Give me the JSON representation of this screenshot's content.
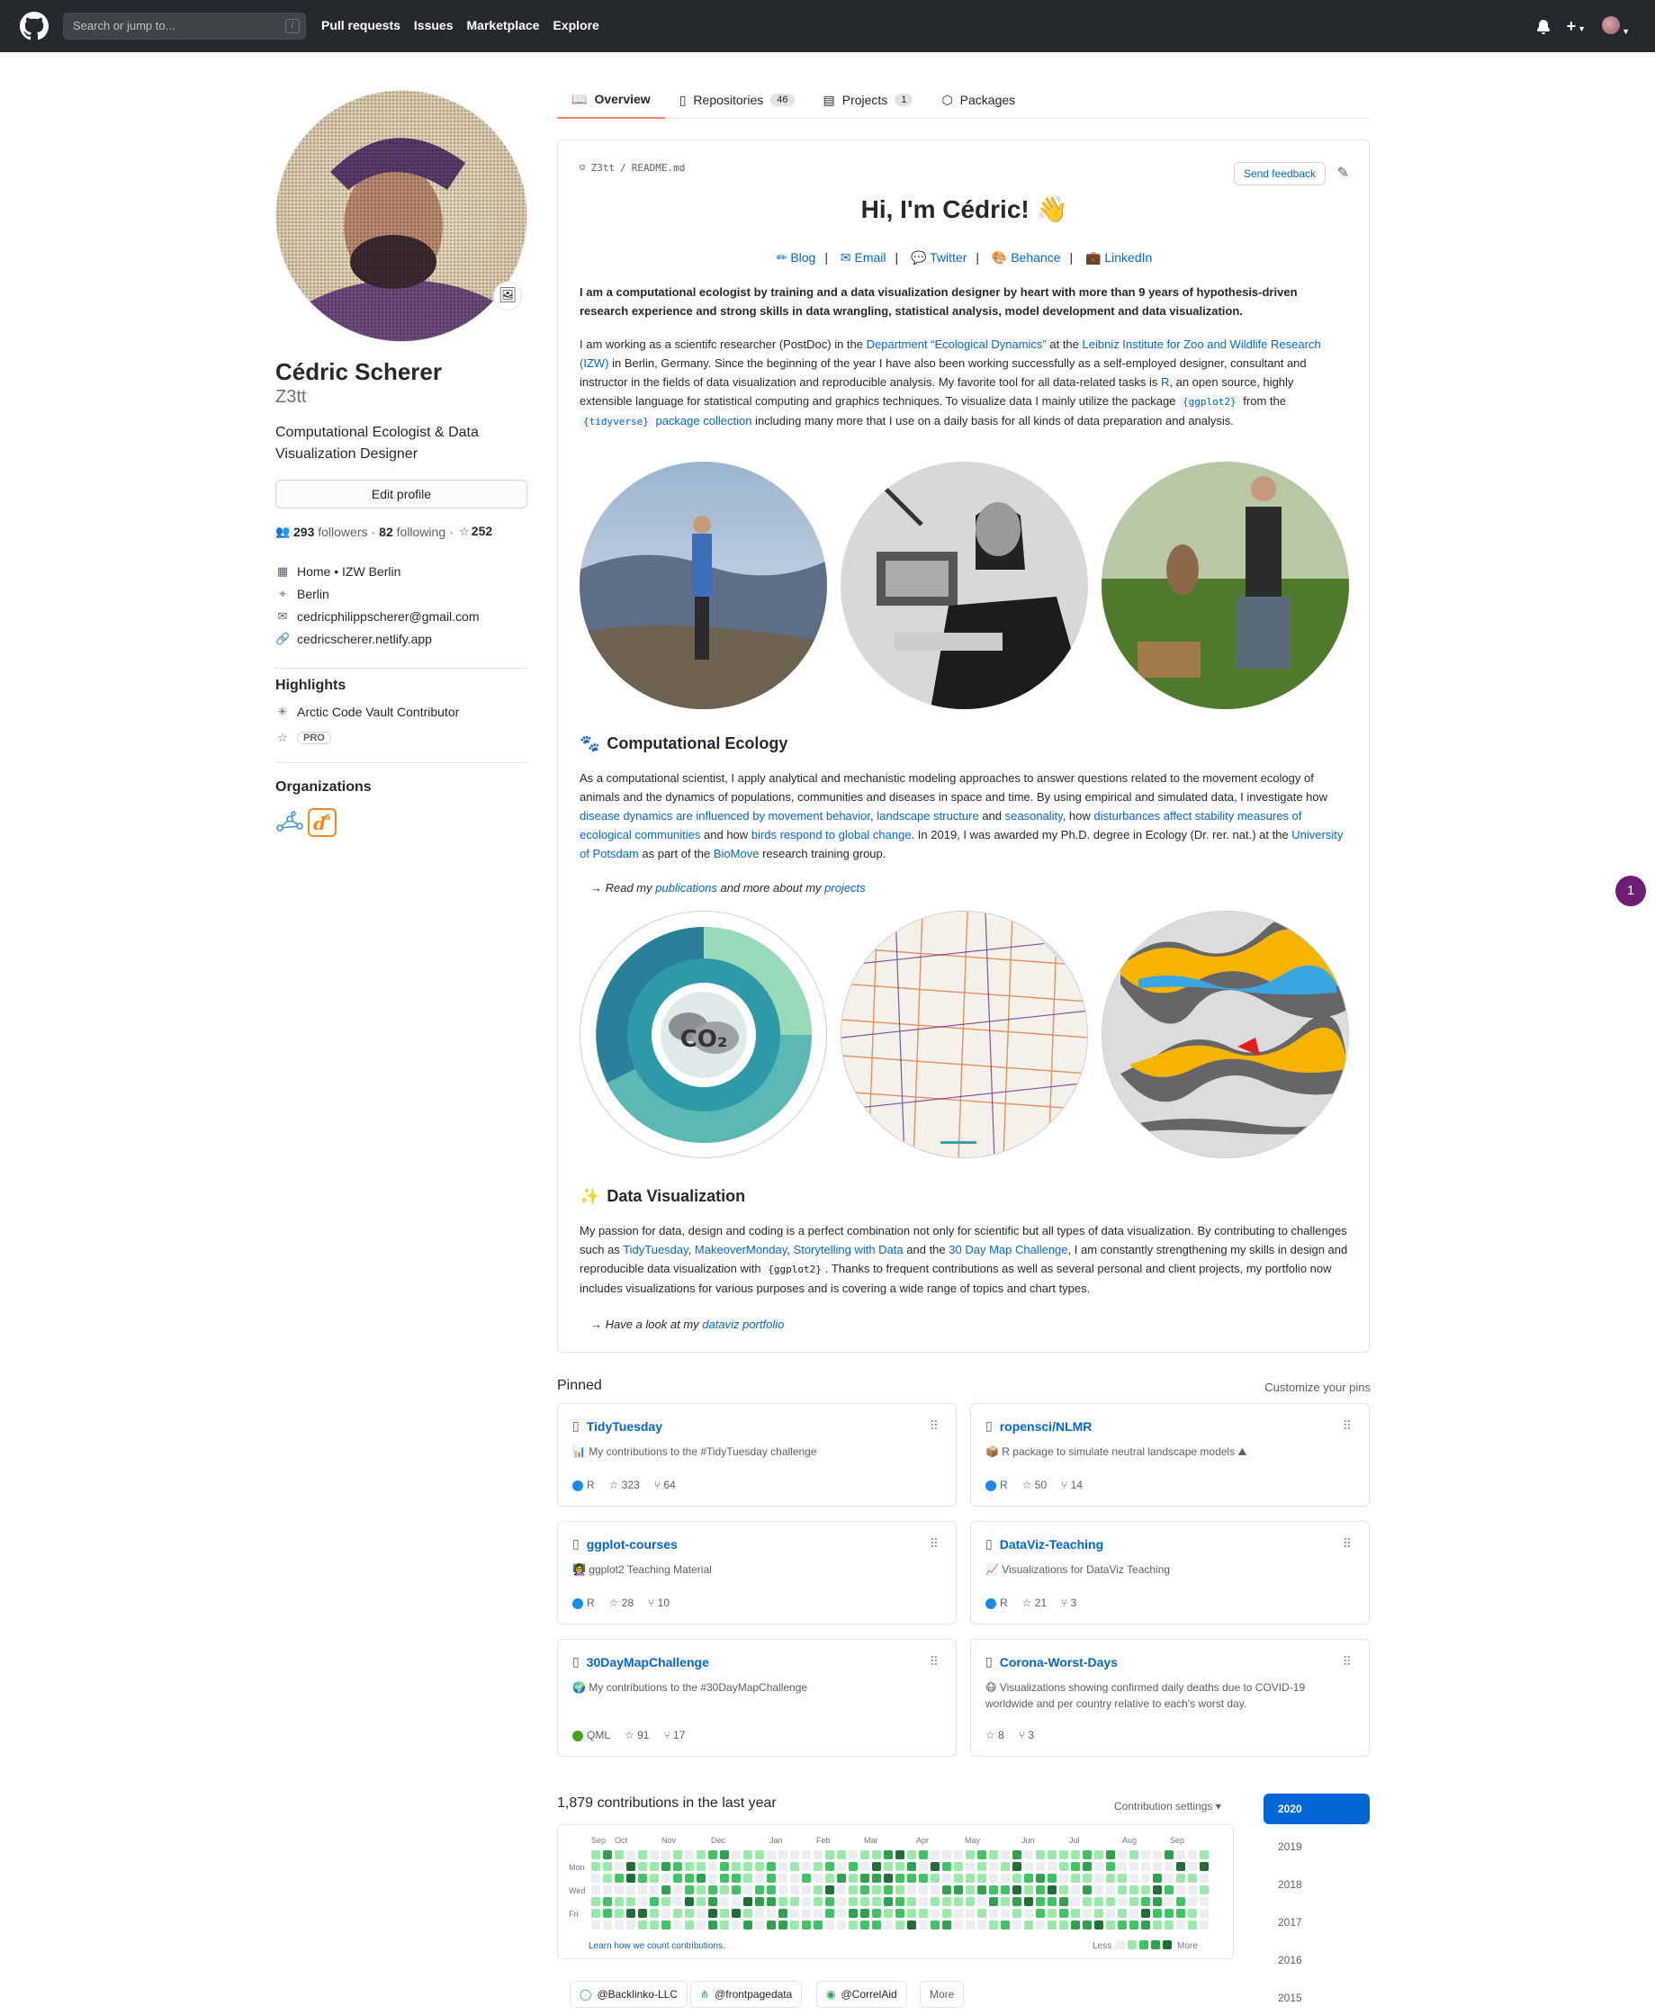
{
  "header": {
    "search_placeholder": "Search or jump to...",
    "search_shortcut": "/",
    "nav": [
      "Pull requests",
      "Issues",
      "Marketplace",
      "Explore"
    ]
  },
  "profile": {
    "fullname": "Cédric Scherer",
    "username": "Z3tt",
    "bio": "Computational Ecologist & Data Visualization Designer",
    "edit_label": "Edit profile",
    "followers_count": "293",
    "followers_label": "followers",
    "following_count": "82",
    "following_label": "following",
    "stars_count": "252",
    "company": "Home • IZW Berlin",
    "location": "Berlin",
    "email": "cedricphilippscherer@gmail.com",
    "website": "cedricscherer.netlify.app",
    "highlights_title": "Highlights",
    "highlight_1": "Arctic Code Vault Contributor",
    "pro_label": "PRO",
    "orgs_title": "Organizations"
  },
  "tabs": [
    {
      "label": "Overview"
    },
    {
      "label": "Repositories",
      "count": "46"
    },
    {
      "label": "Projects",
      "count": "1"
    },
    {
      "label": "Packages"
    }
  ],
  "readme": {
    "owner": "Z3tt",
    "file": "README.md",
    "feedback_label": "Send feedback",
    "title": "Hi, I'm Cédric! 👋",
    "links": [
      "Blog",
      "Email",
      "Twitter",
      "Behance",
      "LinkedIn"
    ],
    "intro": "I am a computational ecologist by training and a data visualization designer by heart with more than 9 years of hypothesis-driven research experience and strong skills in data wrangling, statistical analysis, model development and data visualization.",
    "p1_a": "I am working as a scientifc researcher (PostDoc) in the ",
    "p1_link1": "Department “Ecological Dynamics”",
    "p1_b": " at the ",
    "p1_link2": "Leibniz Institute for Zoo and Wildlife Research (IZW)",
    "p1_c": " in Berlin, Germany. Since the beginning of the year I have also been working successfully as a self-employed designer, consultant and instructor in the fields of data visualization and reproducible analysis. My favorite tool for all data-related tasks is ",
    "p1_link3": "R",
    "p1_d": ", an open source, highly extensible language for statistical computing and graphics techniques. To visualize data I mainly utilize the package ",
    "p1_code1": "{ggplot2}",
    "p1_e": " from the ",
    "p1_code2": "{tidyverse}",
    "p1_link4": " package collection",
    "p1_f": " including many more that I use on a daily basis for all kinds of data preparation and analysis.",
    "h_ecology": "Computational Ecology",
    "eco_a": "As a computational scientist, I apply analytical and mechanistic modeling approaches to answer questions related to the movement ecology of animals and the dynamics of populations, communities and diseases in space and time. By using empirical and simulated data, I investigate how ",
    "eco_l1": "disease dynamics are influenced by movement behavior",
    "eco_b": ", ",
    "eco_l2": "landscape structure",
    "eco_c": " and ",
    "eco_l3": "seasonality",
    "eco_d": ", how ",
    "eco_l4": "disturbances affect stability measures of ecological communities",
    "eco_e": " and how ",
    "eco_l5": "birds respond to global change",
    "eco_f": ". In 2019, I was awarded my Ph.D. degree in Ecology (Dr. rer. nat.) at the ",
    "eco_l6": "University of Potsdam",
    "eco_g": " as part of the ",
    "eco_l7": "BioMove",
    "eco_h": " research training group.",
    "read_a": "→ Read my ",
    "read_l1": "publications",
    "read_b": " and more about my ",
    "read_l2": "projects",
    "h_dataviz": "Data Visualization",
    "dv_a": "My passion for data, design and coding is a perfect combination not only for scientific but all types of data visualization. By contributing to challenges such as ",
    "dv_l1": "TidyTuesday",
    "dv_b": ", ",
    "dv_l2": "MakeoverMonday",
    "dv_l3": "Storytelling with Data",
    "dv_c": " and the ",
    "dv_l4": "30 Day Map Challenge",
    "dv_d": ", I am constantly strengthening my skills in design and reproducible data visualization with ",
    "dv_code": "{ggplot2}",
    "dv_e": ". Thanks to frequent contributions as well as several personal and client projects, my portfolio now includes visualizations for various purposes and is covering a wide range of topics and chart types.",
    "look_a": "→ Have a look at my ",
    "look_l": "dataviz portfolio",
    "co2_label": "CO₂"
  },
  "pinned": {
    "title": "Pinned",
    "customize": "Customize your pins",
    "repos": [
      {
        "name": "TidyTuesday",
        "desc": "📊 My contributions to the #TidyTuesday challenge",
        "lang": "R",
        "lang_color": "#198ce7",
        "stars": "323",
        "forks": "64"
      },
      {
        "name": "ropensci/NLMR",
        "desc": "📦 R package to simulate neutral landscape models ⛰",
        "lang": "R",
        "lang_color": "#198ce7",
        "stars": "50",
        "forks": "14"
      },
      {
        "name": "ggplot-courses",
        "desc": "👩‍🏫 ggplot2 Teaching Material",
        "lang": "R",
        "lang_color": "#198ce7",
        "stars": "28",
        "forks": "10"
      },
      {
        "name": "DataViz-Teaching",
        "desc": "📈 Visualizations for DataViz Teaching",
        "lang": "R",
        "lang_color": "#198ce7",
        "stars": "21",
        "forks": "3"
      },
      {
        "name": "30DayMapChallenge",
        "desc": "🌍 My contributions to the #30DayMapChallenge",
        "lang": "QML",
        "lang_color": "#44a51c",
        "stars": "91",
        "forks": "17"
      },
      {
        "name": "Corona-Worst-Days",
        "desc": "😷 Visualizations showing confirmed daily deaths due to COVID-19 worldwide and per country relative to each's worst day.",
        "lang": "",
        "lang_color": "",
        "stars": "8",
        "forks": "3"
      }
    ]
  },
  "contributions": {
    "title": "1,879 contributions in the last year",
    "settings_label": "Contribution settings ▾",
    "months": [
      "Sep",
      "Oct",
      "Nov",
      "Dec",
      "Jan",
      "Feb",
      "Mar",
      "Apr",
      "May",
      "Jun",
      "Jul",
      "Aug",
      "Sep"
    ],
    "days": [
      "Mon",
      "Wed",
      "Fri"
    ],
    "learn": "Learn how we count contributions.",
    "less": "Less",
    "more": "More",
    "years": [
      "2020",
      "2019",
      "2018",
      "2017",
      "2016",
      "2015"
    ],
    "filters": [
      "@Backlinko-LLC",
      "@frontpagedata",
      "@CorrelAid"
    ],
    "filters_more": "More"
  },
  "notification_count": "1"
}
